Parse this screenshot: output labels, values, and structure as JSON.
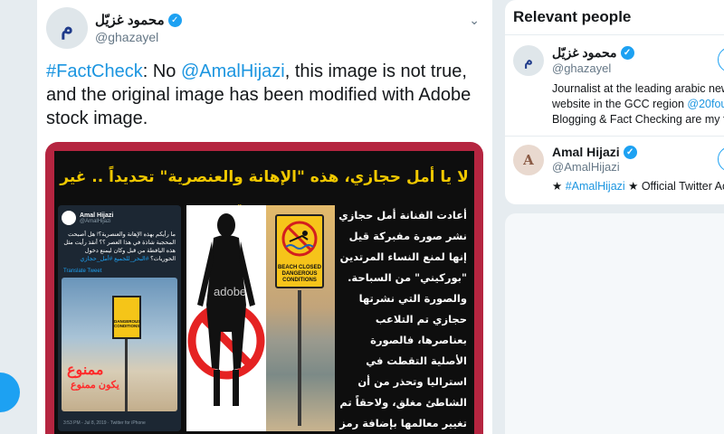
{
  "tweet": {
    "author_name": "محمود غزيّل",
    "author_handle": "@ghazayel",
    "author_mark": "م",
    "text_hashtag": "#FactCheck",
    "text_part1": ": No ",
    "text_mention": "@AmalHijazi",
    "text_part2": ", this image is not true, and the original image has been modified with Adobe stock image."
  },
  "media": {
    "banner": "لا يا أمل حجازي، هذه \"الإهانة والعنصرية\" تحديداً .. غير موجودة",
    "embedded_tweet": {
      "name": "Amal Hijazi",
      "handle": "@AmalHijazi",
      "text": "ما رأيكم بهذه الإهانة والعنصرية؟! هل أصبحت المحجبة شاذة في هذا العصر ؟؟ أنقذ رأيت مثل هذه اليافطة من قبل وكان ليمنع دخول الحوريات؟",
      "tags": "#البحر_للجميع #أمل_حجازي",
      "translate": "Translate Tweet",
      "photo_red_1": "ممنوع",
      "photo_red_2": "يكون ممنوع",
      "sign_text": "DANGEROUS CONDITIONS",
      "footer": "3:53 PM - Jul 8, 2019 · Twitter for iPhone"
    },
    "watermark": "adobe",
    "beach_sign_text": "BEACH CLOSED DANGEROUS CONDITIONS",
    "arabic_body": "أعادت الفنانة أمل حجازي نشر صورة مفبركة قيل إنها لمنع النساء المرتدين \"بوركيني\" من السباحة. والصورة التي نشرتها حجازي تم التلاعب بعناصرها، فالصورة الأصلية التقطت في استراليا وتحذر من أن الشاطئ مغلق، ولاحقاً تم تغيير معالمها بإضافة رمز من خزانة \"أدوبي\" للصورة الجاهزة."
  },
  "sidebar": {
    "title": "Relevant people",
    "people": [
      {
        "name": "محمود غزيّل",
        "handle": "@ghazayel",
        "mark": "م",
        "bio_line1": "Journalist at the leading arabic new",
        "bio_line2_prefix": "website in the GCC region ",
        "bio_line2_link": "@20fou",
        "bio_line3": "Blogging & Fact Checking are my f"
      },
      {
        "name": "Amal Hijazi",
        "handle": "@AmalHijazi",
        "mark": "A",
        "bio_prefix": "★ ",
        "bio_link": "#AmalHijazi",
        "bio_suffix": " ★ Official Twitter Ac"
      }
    ]
  },
  "colors": {
    "accent": "#1da1f2",
    "link": "#1b95e0",
    "media_border": "#b52540",
    "banner_text": "#f0c800"
  }
}
